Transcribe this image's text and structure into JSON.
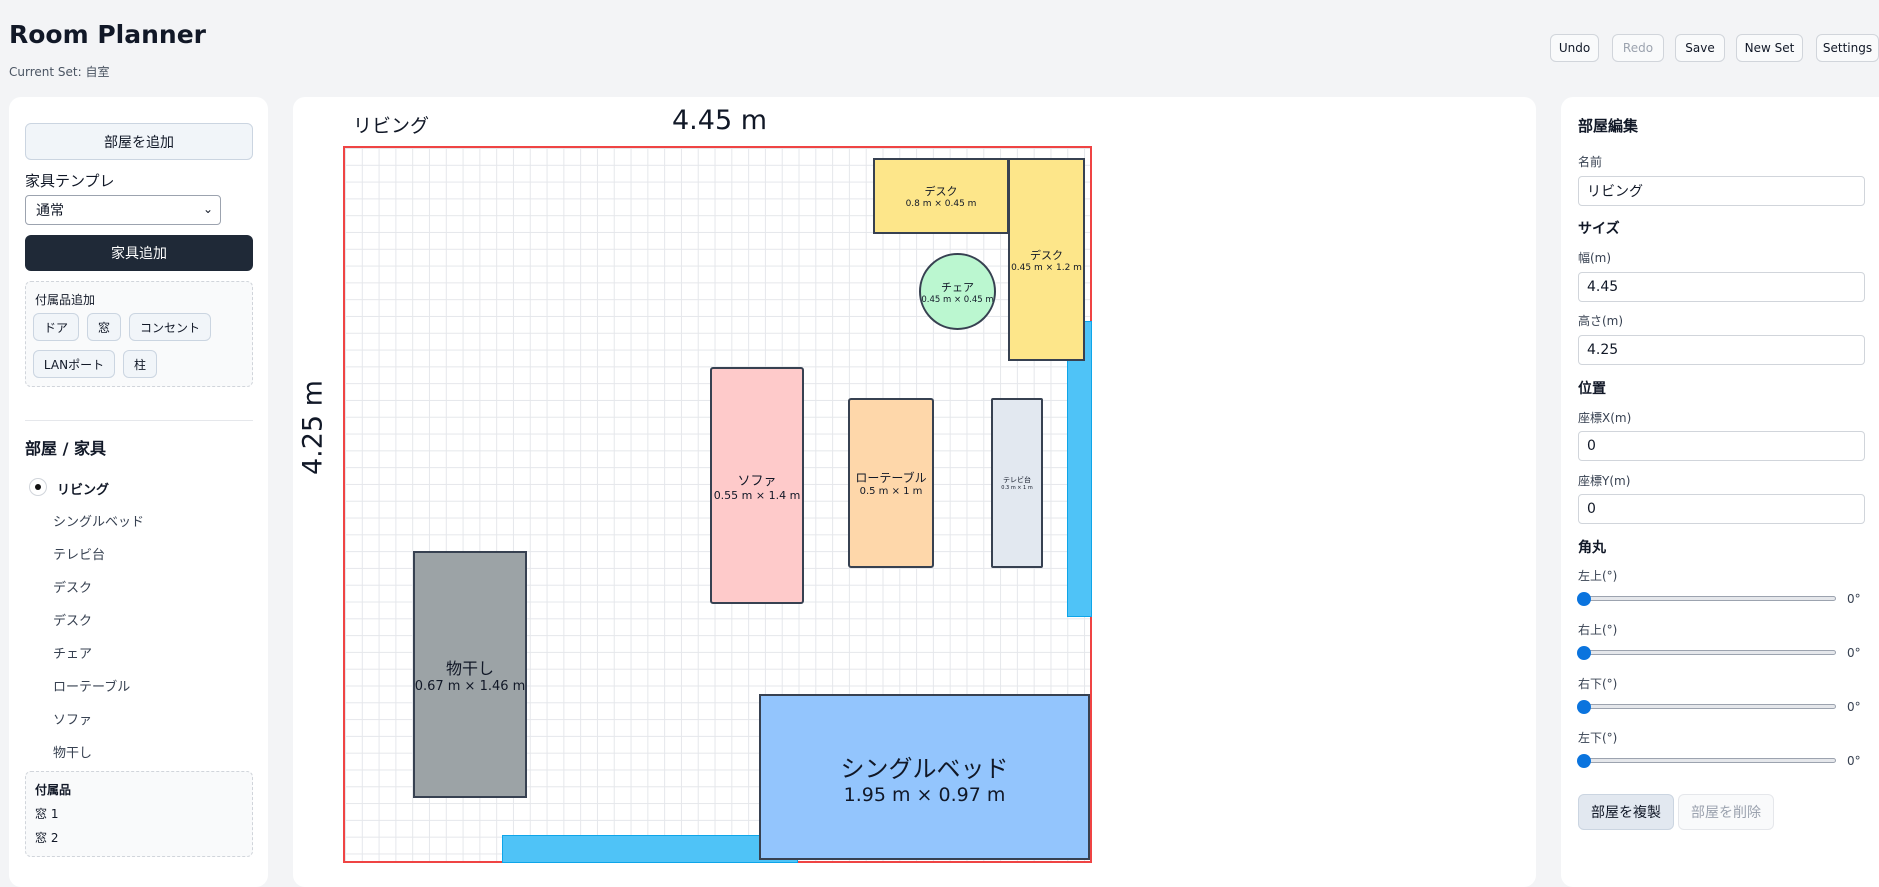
{
  "app": {
    "title": "Room Planner",
    "current_set": "Current Set: 自室"
  },
  "toolbar": {
    "undo": "Undo",
    "redo": "Redo",
    "save": "Save",
    "new_set": "New Set",
    "settings": "Settings"
  },
  "left": {
    "add_room": "部屋を追加",
    "furniture_template_label": "家具テンプレ",
    "template_selected": "通常",
    "add_furniture": "家具追加",
    "accessories_title": "付属品追加",
    "accessory_buttons": [
      "ドア",
      "窓",
      "コンセント",
      "LANポート",
      "柱"
    ],
    "tree_title": "部屋 / 家具",
    "tree_room": "リビング",
    "tree_items": [
      "シングルベッド",
      "テレビ台",
      "デスク",
      "デスク",
      "チェア",
      "ローテーブル",
      "ソファ",
      "物干し"
    ],
    "tree_accessories_title": "付属品",
    "tree_accessories": [
      "窓 1",
      "窓 2"
    ]
  },
  "canvas": {
    "room_name": "リビング",
    "width_label": "4.45 m",
    "height_label": "4.25 m",
    "furniture": [
      {
        "name": "デスク",
        "size": "0.8 m × 0.45 m",
        "color": "#fde68a"
      },
      {
        "name": "デスク",
        "size": "0.45 m × 1.2 m",
        "color": "#fde68a"
      },
      {
        "name": "チェア",
        "size": "0.45 m × 0.45 m",
        "color": "#bbf7d0"
      },
      {
        "name": "ソファ",
        "size": "0.55 m × 1.4 m",
        "color": "#fecaca"
      },
      {
        "name": "ローテーブル",
        "size": "0.5 m × 1 m",
        "color": "#fed7aa"
      },
      {
        "name": "テレビ台",
        "size": "0.3 m × 1 m",
        "color": "#e2e8f0"
      },
      {
        "name": "物干し",
        "size": "0.67 m × 1.46 m",
        "color": "#9ca3a6"
      },
      {
        "name": "シングルベッド",
        "size": "1.95 m × 0.97 m",
        "color": "#93c5fd"
      }
    ],
    "window_color": "#4fc3f7",
    "room_border_color": "#ef4444"
  },
  "right": {
    "title": "部屋編集",
    "name_label": "名前",
    "name_value": "リビング",
    "size_section": "サイズ",
    "width_label": "幅(m)",
    "width_value": "4.45",
    "height_label": "高さ(m)",
    "height_value": "4.25",
    "position_section": "位置",
    "x_label": "座標X(m)",
    "x_value": "0",
    "y_label": "座標Y(m)",
    "y_value": "0",
    "corner_section": "角丸",
    "corners": [
      {
        "label": "左上(°)",
        "value": "0°"
      },
      {
        "label": "右上(°)",
        "value": "0°"
      },
      {
        "label": "右下(°)",
        "value": "0°"
      },
      {
        "label": "左下(°)",
        "value": "0°"
      }
    ],
    "duplicate": "部屋を複製",
    "delete": "部屋を削除"
  }
}
